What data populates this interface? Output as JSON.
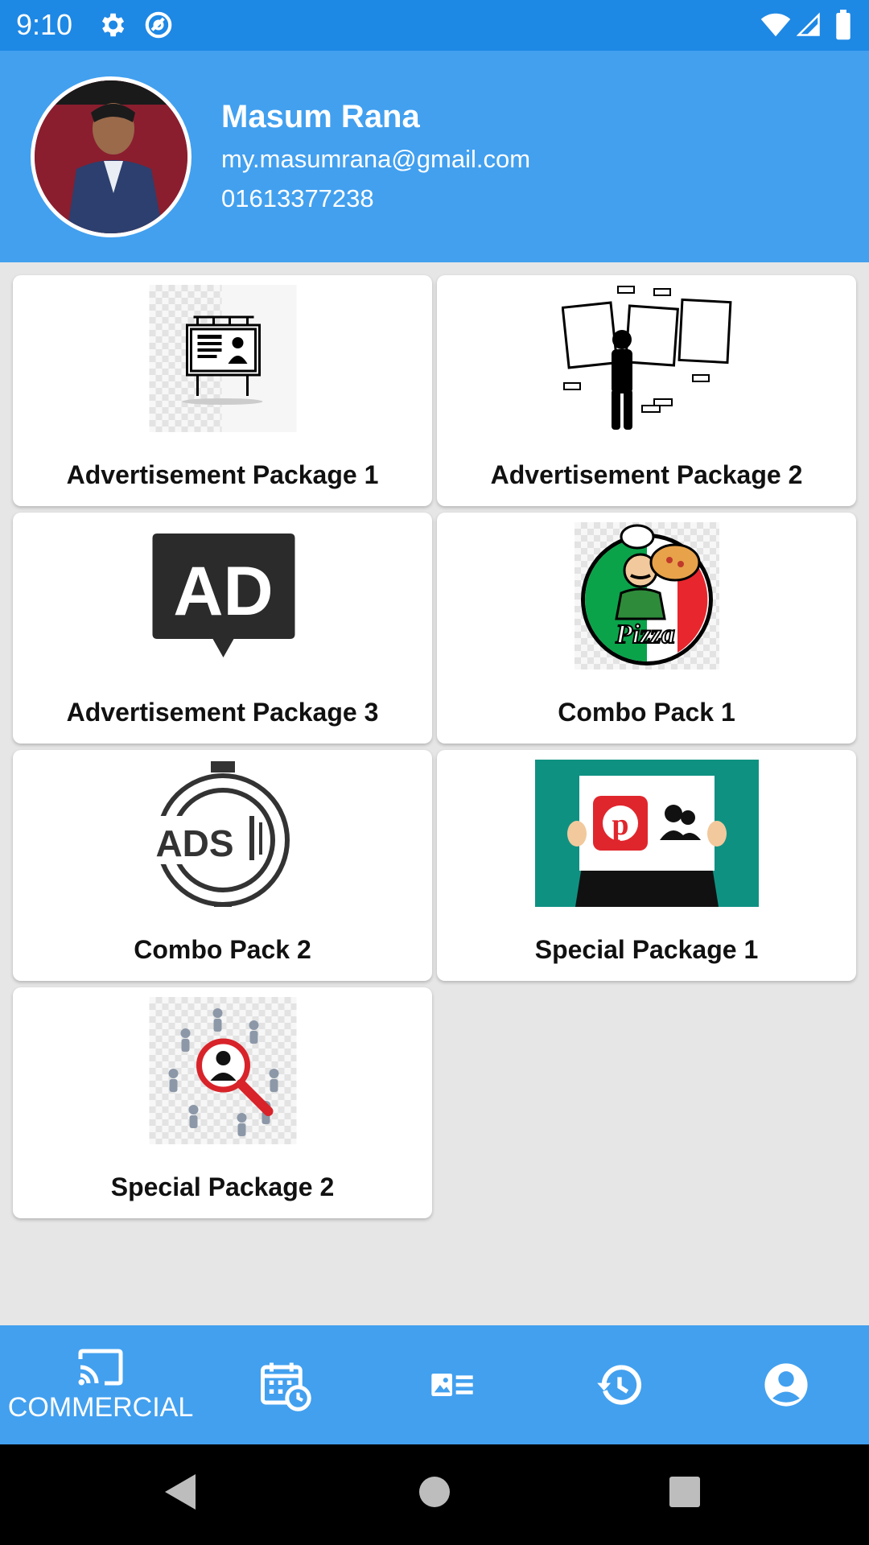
{
  "status_bar": {
    "time": "9:10"
  },
  "profile": {
    "name": "Masum Rana",
    "email": "my.masumrana@gmail.com",
    "phone": "01613377238"
  },
  "packages": [
    {
      "label": "Advertisement Package 1",
      "icon": "billboard-icon"
    },
    {
      "label": "Advertisement Package 2",
      "icon": "person-frames-icon"
    },
    {
      "label": "Advertisement Package 3",
      "icon": "ad-bubble-icon"
    },
    {
      "label": "Combo Pack 1",
      "icon": "pizza-chef-icon"
    },
    {
      "label": "Combo Pack 2",
      "icon": "ads-target-icon"
    },
    {
      "label": "Special Package 1",
      "icon": "pinterest-sign-icon"
    },
    {
      "label": "Special Package 2",
      "icon": "people-search-icon"
    }
  ],
  "bottom_nav": {
    "items": [
      {
        "label": "COMMERCIAL",
        "icon": "cast-icon",
        "active": true
      },
      {
        "label": "",
        "icon": "calendar-clock-icon"
      },
      {
        "label": "",
        "icon": "image-list-icon"
      },
      {
        "label": "",
        "icon": "history-icon"
      },
      {
        "label": "",
        "icon": "account-circle-icon"
      }
    ]
  },
  "colors": {
    "header": "#42a0ef",
    "status_bar": "#1e88e5",
    "card": "#ffffff",
    "background": "#e6e6e6"
  }
}
